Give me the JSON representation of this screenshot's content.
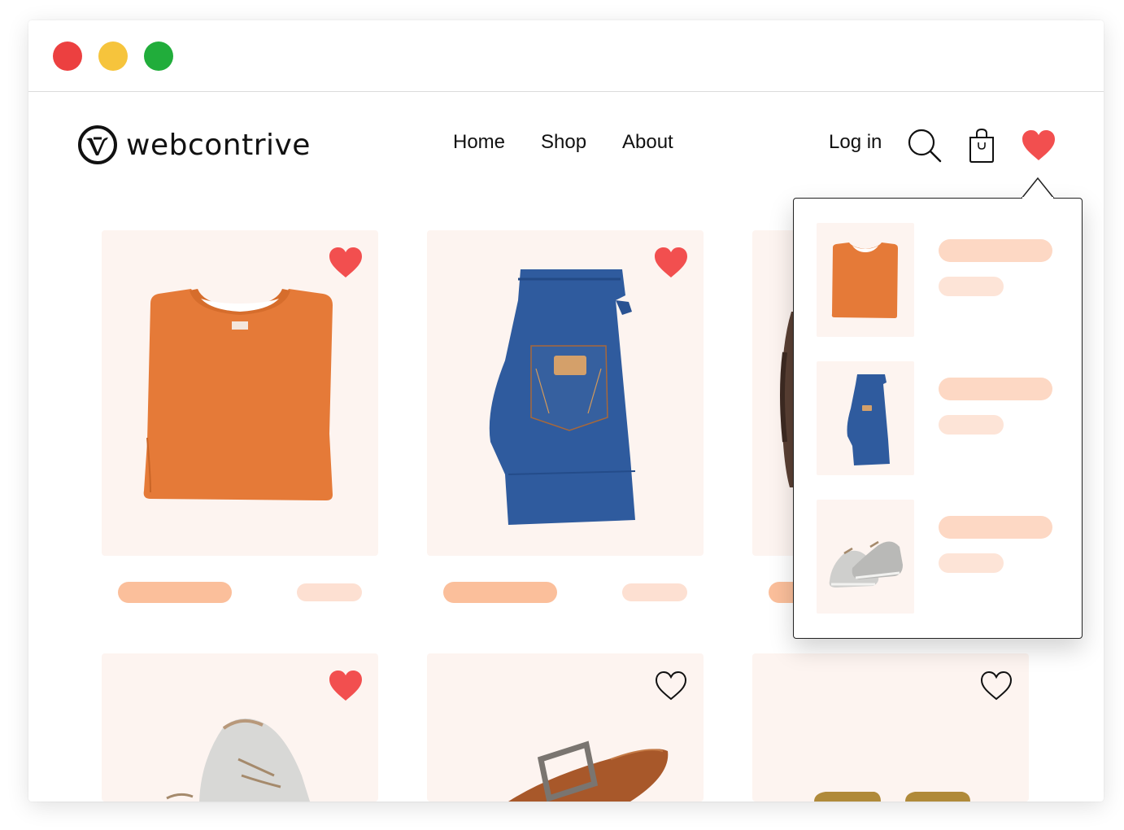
{
  "window": {
    "controls": [
      "close",
      "minimize",
      "maximize"
    ],
    "colors": {
      "close": "#ec4040",
      "minimize": "#f6c43c",
      "maximize": "#21ad3b"
    }
  },
  "header": {
    "brand": "webcontrive",
    "logo_icon": "webcontrive-logo-icon",
    "nav": [
      {
        "label": "Home"
      },
      {
        "label": "Shop"
      },
      {
        "label": "About"
      }
    ],
    "login_label": "Log in",
    "icons": [
      "search-icon",
      "shopping-bag-icon",
      "heart-icon"
    ]
  },
  "products": [
    {
      "item": "orange t-shirt",
      "favorited": true
    },
    {
      "item": "blue jeans",
      "favorited": true
    },
    {
      "item": "brown boots",
      "favorited": true
    },
    {
      "item": "grey sneakers",
      "favorited": true
    },
    {
      "item": "brown leather belt",
      "favorited": false
    },
    {
      "item": "sunglasses",
      "favorited": false
    }
  ],
  "favorites_popup": {
    "items": [
      {
        "item": "orange t-shirt"
      },
      {
        "item": "blue jeans"
      },
      {
        "item": "grey sneakers"
      }
    ]
  },
  "colors": {
    "accent_heart": "#f24f4f",
    "card_bg": "#fdf4f0",
    "placeholder_title": "#fbbf9b",
    "placeholder_price": "#fde0d2"
  }
}
